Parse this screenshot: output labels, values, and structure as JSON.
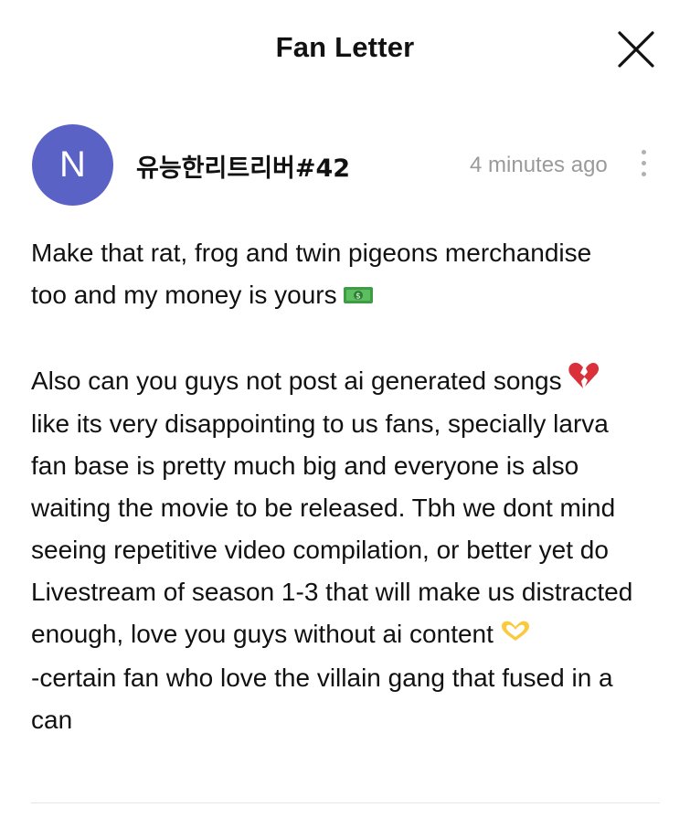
{
  "header": {
    "title": "Fan Letter",
    "close_icon": "close-icon"
  },
  "author": {
    "avatar_letter": "N",
    "avatar_color": "#5a62c6",
    "name": "유능한리트리버#42",
    "timestamp": "4 minutes ago",
    "more_icon": "more-vertical-icon"
  },
  "letter": {
    "p1_line1": "Make that rat, frog and twin pigeons merchandise",
    "p1_line2": "too and my money is yours",
    "p1_emoji": "money-banknote-icon",
    "p2_line1": "Also can you guys not post ai generated songs",
    "p2_line1_emoji": "broken-heart-icon",
    "p2_line2": "like its very disappointing to us fans, specially larva",
    "p2_line3": "fan base is pretty much big and everyone is also",
    "p2_line4": "waiting the movie to be released. Tbh we dont mind",
    "p2_line5": "seeing repetitive video compilation, or better yet do",
    "p2_line6": "Livestream of season 1-3 that will make us distracted",
    "p2_line7": "enough, love you guys without ai content",
    "p2_line7_emoji": "heart-hands-icon",
    "p2_line8": "-certain fan who love the villain gang that fused in a",
    "p2_line9": "can"
  }
}
